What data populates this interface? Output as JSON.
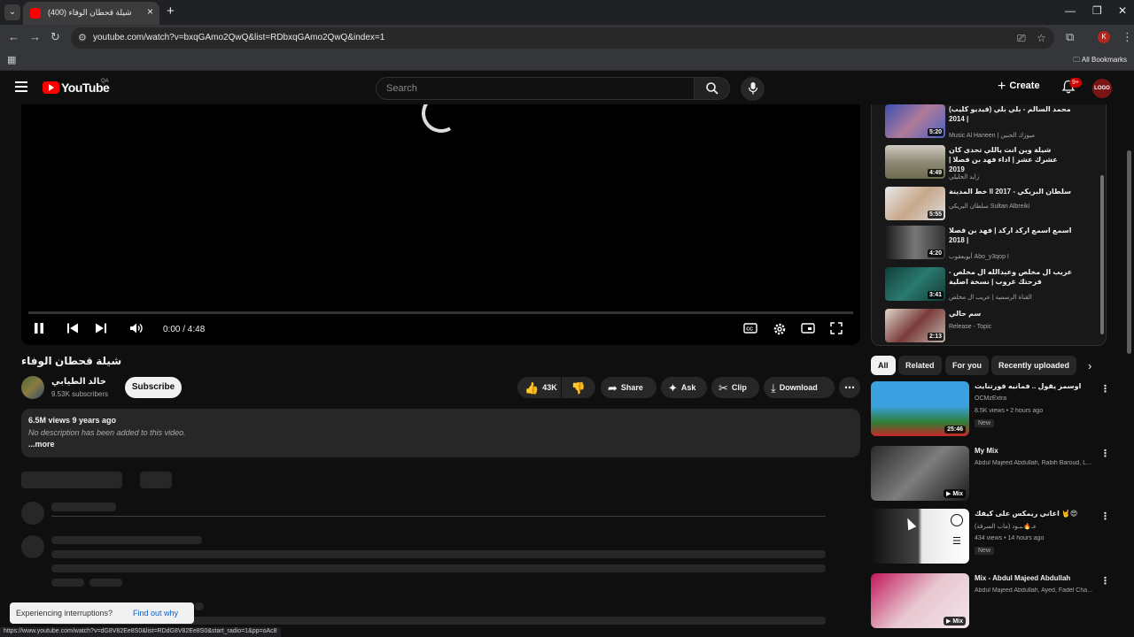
{
  "browser": {
    "tab_title": "(400) شيلة قحطان الوفاء",
    "url": "youtube.com/watch?v=bxqGAmo2QwQ&list=RDbxqGAmo2QwQ&index=1",
    "all_bookmarks": "All Bookmarks",
    "profile_letter": "K",
    "status_url": "https://www.youtube.com/watch?v=dG8V82Ee8S0&list=RDdG8V82Ee8S0&start_radio=1&pp=oAc8"
  },
  "header": {
    "logo_text": "YouTube",
    "country_code": "QA",
    "search_placeholder": "Search",
    "create_label": "Create",
    "notification_count": "9+",
    "avatar_text": "LOGO"
  },
  "player": {
    "time": "0:00 / 4:48",
    "progress_fraction": 0
  },
  "video": {
    "title": "شيلة قحطان الوفاء",
    "channel_name": "خالد الطيابي",
    "subscribers": "9.53K subscribers",
    "subscribe_label": "Subscribe",
    "likes": "43K",
    "share_label": "Share",
    "ask_label": "Ask",
    "clip_label": "Clip",
    "download_label": "Download",
    "views_age": "6.5M views  9 years ago",
    "description": "No description has been added to this video.",
    "more_label": "...more"
  },
  "toast": {
    "text": "Experiencing interruptions?",
    "link": "Find out why"
  },
  "playlist": {
    "items": [
      {
        "title": "محمد السالم - بلي بلي (فيديو كليب) | 2014",
        "channel": "Music Al Haneen | ميوزك الحنين",
        "duration": "5:20"
      },
      {
        "title": "شيلة وين انت ياللي تحدى كان عشرك عشر | اداء فهد بن فصلا | 2019",
        "channel": "زايد الحليلي",
        "duration": "4:49"
      },
      {
        "title": "سلطان البريكي - 2017 ll خط المدينة",
        "channel": "سلطان البريكي Sultan Albreiki",
        "duration": "5:55"
      },
      {
        "title": "اسمع اسمع اركد اركد | فهد بن فصلا | 2018",
        "channel": "أبويعقوب Abo_y3qop I",
        "duration": "4:20"
      },
      {
        "title": "عريب ال مخلص وعبدالله ال مخلص - فرحتك غروب | نسخة اصلية",
        "channel": "القناة الرسمية | عريب ال مخلص",
        "duration": "3:41"
      },
      {
        "title": "سم حالي",
        "channel": "Release - Topic",
        "duration": "2:13"
      }
    ]
  },
  "chips": [
    "All",
    "Related",
    "For you",
    "Recently uploaded"
  ],
  "recommendations": [
    {
      "title": "اوسمز يقول .. فمانيه فورتنايت",
      "line1": "OCMzExtra",
      "line2": "8.5K views • 2 hours ago",
      "badge": "New",
      "duration": "25:46"
    },
    {
      "title": "My Mix",
      "line1": "Abdul Majeed Abdullah, Rabih Baroud, L...",
      "line2": "",
      "badge": "",
      "duration": "Mix"
    },
    {
      "title": "اغاني ريمكس على كيفك 🤘😍",
      "line1": "عـ🔥ـبـود (ماب السرقة)",
      "line2": "434 views • 14 hours ago",
      "badge": "New",
      "duration": ""
    },
    {
      "title": "Mix - Abdul Majeed Abdullah",
      "line1": "Abdul Majeed Abdullah, Ayed, Fadel Cha...",
      "line2": "",
      "badge": "",
      "duration": "Mix"
    }
  ]
}
